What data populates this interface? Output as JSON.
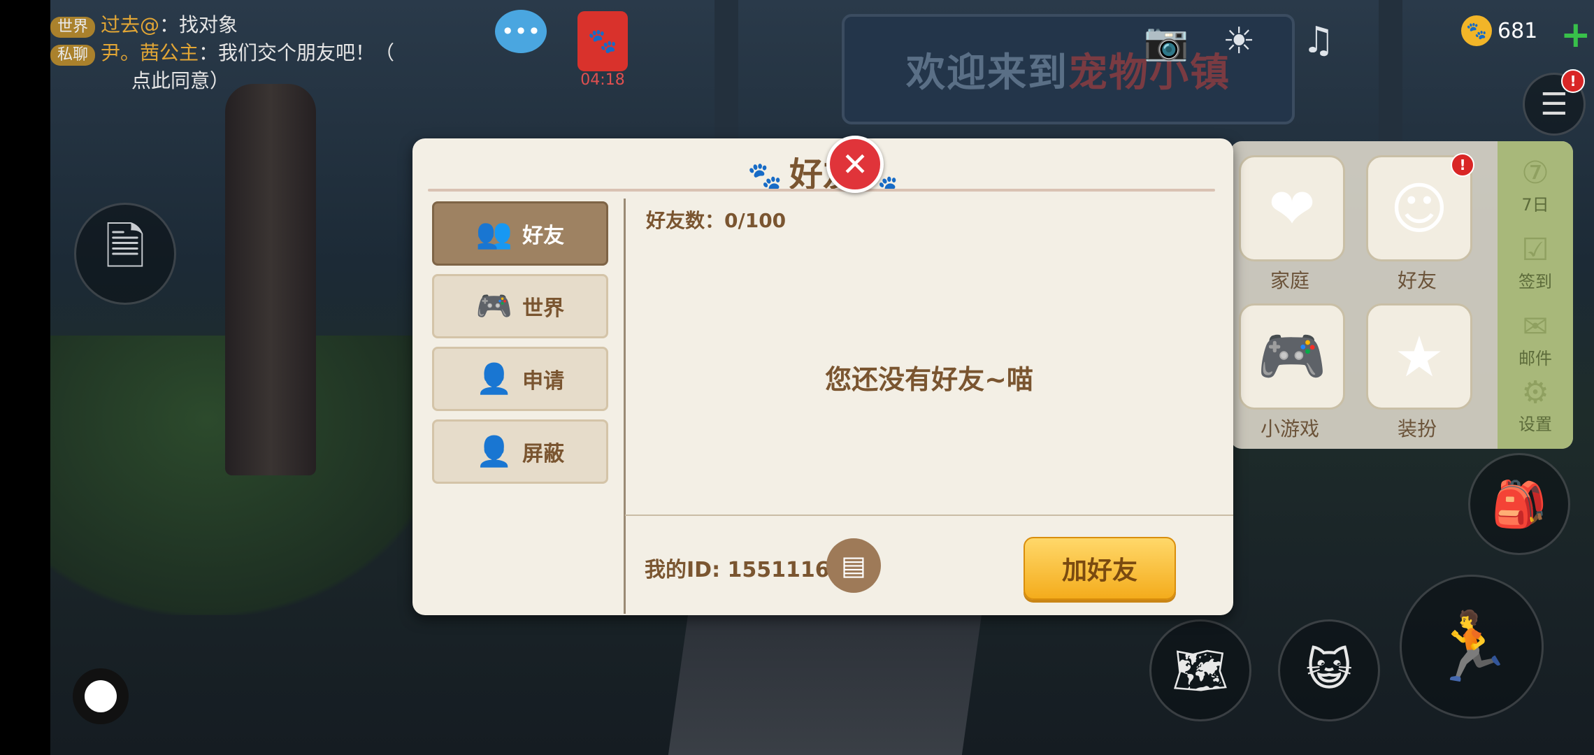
{
  "chat": {
    "line1": {
      "tag": "世界",
      "name": "过去@",
      "msg": "：找对象"
    },
    "line2": {
      "tag": "私聊",
      "name": "尹。茜公主",
      "msg": "：我们交个朋友吧！（",
      "msg_cont": "点此同意）"
    }
  },
  "redpacket_time": "04:18",
  "sign_text_1": "欢迎来到",
  "sign_text_2": "宠物小镇",
  "coins": "681",
  "right_menu": {
    "tiles": [
      {
        "label": "家庭",
        "icon": "heart-icon"
      },
      {
        "label": "好友",
        "icon": "friends-icon"
      },
      {
        "label": "小游戏",
        "icon": "gamepad-icon"
      },
      {
        "label": "装扮",
        "icon": "star-wand-icon"
      }
    ],
    "side": [
      {
        "label": "7日",
        "icon": "seven-day-icon"
      },
      {
        "label": "签到",
        "icon": "checkin-icon"
      },
      {
        "label": "邮件",
        "icon": "mail-icon"
      },
      {
        "label": "设置",
        "icon": "gear-icon"
      }
    ]
  },
  "dialog": {
    "title": "好友",
    "tabs": [
      "好友",
      "世界",
      "申请",
      "屏蔽"
    ],
    "count_text": "好友数：0/100",
    "empty_text": "您还没有好友~喵",
    "my_id_text": "我的ID: 15511164",
    "add_button": "加好友",
    "close_symbol": "✕"
  },
  "colors": {
    "accent": "#7a5530",
    "close": "#e0343a",
    "add_button": "#f4ac1c"
  }
}
